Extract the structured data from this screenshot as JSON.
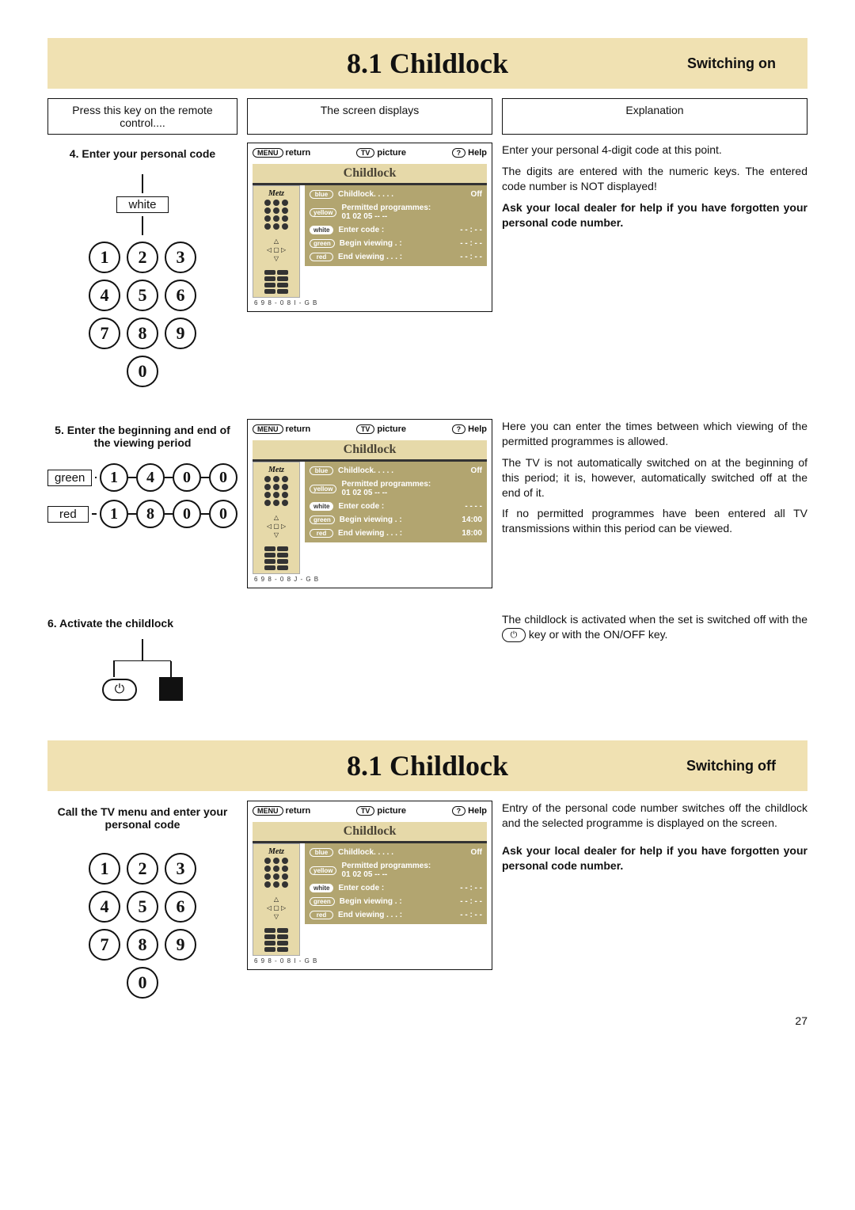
{
  "page_number": "27",
  "section1": {
    "title": "8.1 Childlock",
    "subtitle": "Switching on",
    "colhead": {
      "remote": "Press this key on the remote control....",
      "screen": "The screen displays",
      "explain": "Explanation"
    },
    "step4": {
      "title": "4. Enter your personal code",
      "keypad_label": "white",
      "keys": [
        "1",
        "2",
        "3",
        "4",
        "5",
        "6",
        "7",
        "8",
        "9",
        "0"
      ],
      "tv": {
        "return": "return",
        "picture": "picture",
        "help": "Help",
        "menu_title": "Childlock",
        "line_childlock_label": "Childlock. . . . .",
        "line_childlock_value": "Off",
        "line_permitted": "Permitted programmes:",
        "line_permitted_vals": "01  02  05  --  --",
        "line_enter_code_label": "Enter code  :",
        "line_enter_code_value": "- - : - -",
        "line_begin_label": "Begin viewing . :",
        "line_begin_value": "- - : - -",
        "line_end_label": "End viewing . . . :",
        "line_end_value": "- - : - -",
        "btn_blue": "blue",
        "btn_yellow": "yellow",
        "btn_white": "white",
        "btn_green": "green",
        "btn_red": "red",
        "footer": "6 9 8 - 0 8 I - G B"
      },
      "explain": [
        {
          "t": "Enter your personal 4-digit code at this point.",
          "b": false
        },
        {
          "t": "The digits are entered with the numeric keys. The entered code number is NOT displayed!",
          "b": false
        },
        {
          "t": "Ask your local dealer for help if you have forgotten your personal code number.",
          "b": true
        }
      ]
    },
    "step5": {
      "title": "5. Enter the beginning and end of the viewing period",
      "green_label": "green",
      "green_seq": [
        "1",
        "4",
        "0",
        "0"
      ],
      "red_label": "red",
      "red_seq": [
        "1",
        "8",
        "0",
        "0"
      ],
      "tv": {
        "return": "return",
        "picture": "picture",
        "help": "Help",
        "menu_title": "Childlock",
        "line_childlock_label": "Childlock. . . . .",
        "line_childlock_value": "Off",
        "line_permitted": "Permitted programmes:",
        "line_permitted_vals": "01  02  05  --  --",
        "line_enter_code_label": "Enter code  :",
        "line_enter_code_value": "- - - -",
        "line_begin_label": "Begin viewing . :",
        "line_begin_value": "14:00",
        "line_end_label": "End viewing . . . :",
        "line_end_value": "18:00",
        "footer": "6 9 8 - 0 8 J - G B"
      },
      "explain": [
        {
          "t": "Here you can enter the times between which viewing of the permitted programmes is allowed.",
          "b": false
        },
        {
          "t": "The TV is not automatically switched on at the beginning of this period; it is, however, automatically switched off at the end of it.",
          "b": false
        },
        {
          "t": "If no permitted programmes have been entered all TV transmissions within this period can be viewed.",
          "b": false
        }
      ]
    },
    "step6": {
      "title": "6. Activate the childlock",
      "explain_prefix": "The childlock is activated when the set is switched off with the ",
      "explain_suffix": " key or with the ON/OFF key.",
      "power_glyph": "⏻"
    }
  },
  "section2": {
    "title": "8.1 Childlock",
    "subtitle": "Switching off",
    "step": {
      "title": "Call the TV menu and enter your personal code",
      "keys": [
        "1",
        "2",
        "3",
        "4",
        "5",
        "6",
        "7",
        "8",
        "9",
        "0"
      ],
      "tv": {
        "return": "return",
        "picture": "picture",
        "help": "Help",
        "menu_title": "Childlock",
        "line_childlock_label": "Childlock. . . . .",
        "line_childlock_value": "Off",
        "line_permitted": "Permitted programmes:",
        "line_permitted_vals": "01  02  05  --  --",
        "line_enter_code_label": "Enter code  :",
        "line_enter_code_value": "- - : - -",
        "line_begin_label": "Begin viewing . :",
        "line_begin_value": "- - : - -",
        "line_end_label": "End viewing . . . :",
        "line_end_value": "- - : - -",
        "footer": "6 9 8 - 0 8 I - G B"
      },
      "explain": [
        {
          "t": "Entry of the personal code number switches off the childlock and the selected programme is displayed on the screen.",
          "b": false
        },
        {
          "t": "Ask your local dealer for help if you have forgotten your personal code number.",
          "b": true
        }
      ]
    }
  },
  "tv_btns": {
    "menu": "MENU",
    "tv": "TV",
    "q": "?"
  }
}
